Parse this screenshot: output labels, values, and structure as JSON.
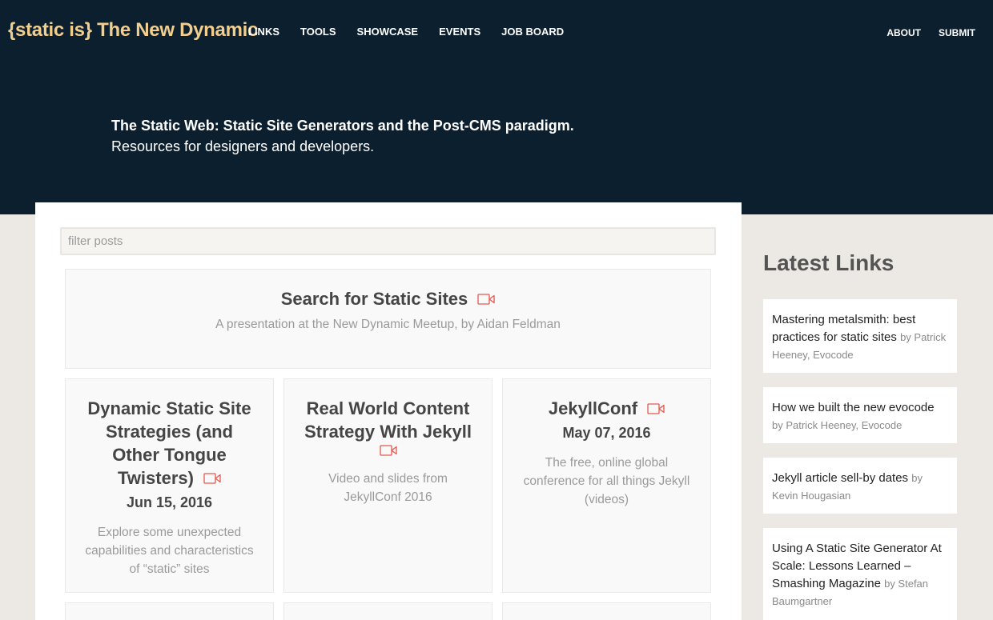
{
  "header": {
    "logo": "{static is} The New Dynamic",
    "nav_left": [
      "LINKS",
      "TOOLS",
      "SHOWCASE",
      "EVENTS",
      "JOB BOARD"
    ],
    "nav_right": [
      "ABOUT",
      "SUBMIT"
    ]
  },
  "hero": {
    "line1": "The Static Web: Static Site Generators and the Post-CMS paradigm.",
    "line2": "Resources for designers and developers."
  },
  "filter": {
    "placeholder": "filter posts",
    "value": ""
  },
  "posts": [
    {
      "title": "Search for Static Sites",
      "description": "A presentation at the New Dynamic Meetup, by Aidan Feldman",
      "icon": "video-icon"
    },
    {
      "title": "Dynamic Static Site Strategies (and Other Tongue Twisters)",
      "date": "Jun 15, 2016",
      "description": "Explore some unexpected capabilities and characteristics of “static” sites",
      "icon": "video-icon"
    },
    {
      "title": "Real World Content Strategy With Jekyll",
      "description": "Video and slides from JekyllConf 2016",
      "icon": "video-icon"
    },
    {
      "title": "JekyllConf",
      "date": "May 07, 2016",
      "description": "The free, online global conference for all things Jekyll (videos)",
      "icon": "video-icon"
    }
  ],
  "sidebar": {
    "title": "Latest Links",
    "links": [
      {
        "title": "Mastering metalsmith: best practices for static sites",
        "by": "by Patrick Heeney, Evocode"
      },
      {
        "title": "How we built the new evocode",
        "by": "by Patrick Heeney, Evocode"
      },
      {
        "title": "Jekyll article sell-by dates",
        "by": "by Kevin Hougasian"
      },
      {
        "title": "Using A Static Site Generator At Scale: Lessons Learned – Smashing Magazine",
        "by": "by Stefan Baumgartner"
      }
    ]
  },
  "colors": {
    "header_bg": "#0c1f2f",
    "logo": "#f3cf8e",
    "accent_video": "#e8574e",
    "page_bg": "#ece9e4"
  }
}
